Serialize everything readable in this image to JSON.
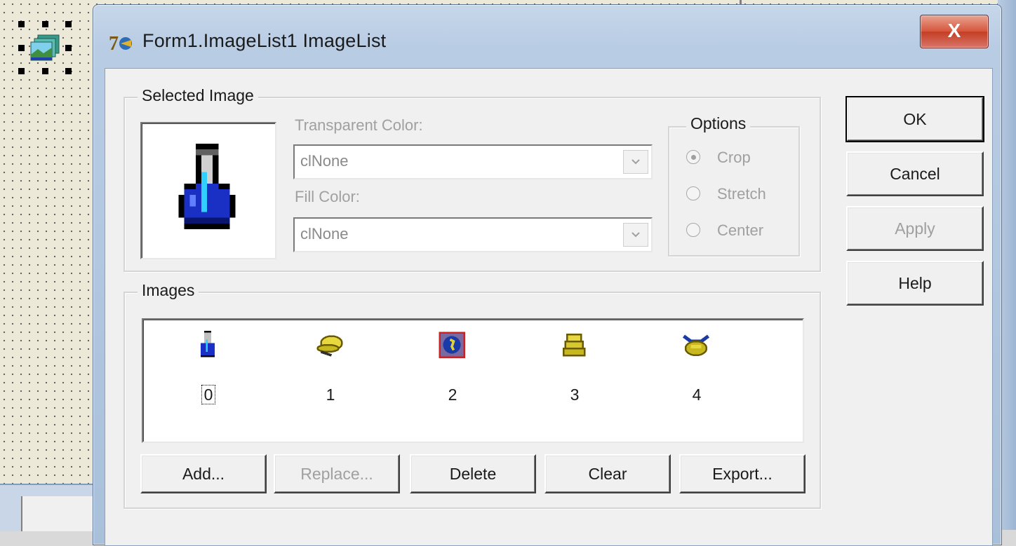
{
  "dialog": {
    "title": "Form1.ImageList1 ImageList",
    "close_label": "X"
  },
  "selected_image": {
    "group_label": "Selected Image",
    "transparent_color_label": "Transparent Color:",
    "transparent_color_value": "clNone",
    "fill_color_label": "Fill Color:",
    "fill_color_value": "clNone",
    "options": {
      "label": "Options",
      "items": [
        {
          "label": "Crop",
          "checked": true
        },
        {
          "label": "Stretch",
          "checked": false
        },
        {
          "label": "Center",
          "checked": false
        }
      ]
    }
  },
  "images": {
    "group_label": "Images",
    "items": [
      {
        "index": "0",
        "icon": "flask-icon",
        "focused": true
      },
      {
        "index": "1",
        "icon": "hat-icon",
        "focused": false
      },
      {
        "index": "2",
        "icon": "globe-icon",
        "focused": false,
        "selected": true
      },
      {
        "index": "3",
        "icon": "stack-icon",
        "focused": false
      },
      {
        "index": "4",
        "icon": "pot-icon",
        "focused": false
      }
    ],
    "buttons": {
      "add": "Add...",
      "replace": "Replace...",
      "delete": "Delete",
      "clear": "Clear",
      "export": "Export..."
    }
  },
  "side_buttons": {
    "ok": "OK",
    "cancel": "Cancel",
    "apply": "Apply",
    "help": "Help"
  },
  "colors": {
    "title_bar": "#b8cce4",
    "close": "#c43e22",
    "disabled": "#a0a0a0"
  }
}
